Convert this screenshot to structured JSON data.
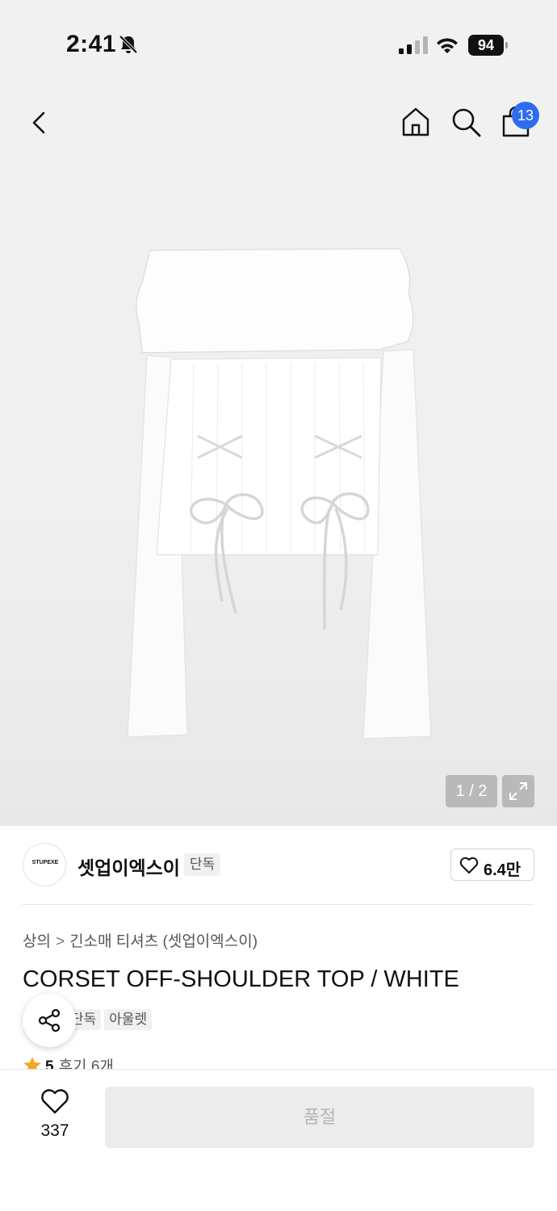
{
  "status_bar": {
    "time": "2:41",
    "battery": "94",
    "icons": [
      "bell-slash-icon",
      "signal-icon",
      "wifi-icon",
      "battery-icon"
    ]
  },
  "nav": {
    "icons": [
      "back-chevron-icon",
      "home-icon",
      "search-icon",
      "shopping-bag-icon"
    ],
    "cart_count": "13"
  },
  "gallery": {
    "counter": "1 / 2",
    "current_image": 1,
    "total_images": 2
  },
  "brand": {
    "logo_text": "STUPEXE",
    "name": "셋업이엑스이",
    "badge": "단독",
    "like_count": "6.4만"
  },
  "product": {
    "breadcrumb": [
      "상의",
      "긴소매 티셔츠 (셋업이엑스이)"
    ],
    "title": "CORSET OFF-SHOULDER TOP / WHITE",
    "tags": [
      "단독",
      "아울렛"
    ],
    "rating": "5",
    "review_label": "후기 6개"
  },
  "bottom_bar": {
    "wish_count": "337",
    "soldout_label": "품절"
  },
  "colors": {
    "badge_blue": "#2e6bf0",
    "star": "#f5a623",
    "disabled_bg": "#ececec",
    "disabled_text": "#b4b4b4"
  }
}
